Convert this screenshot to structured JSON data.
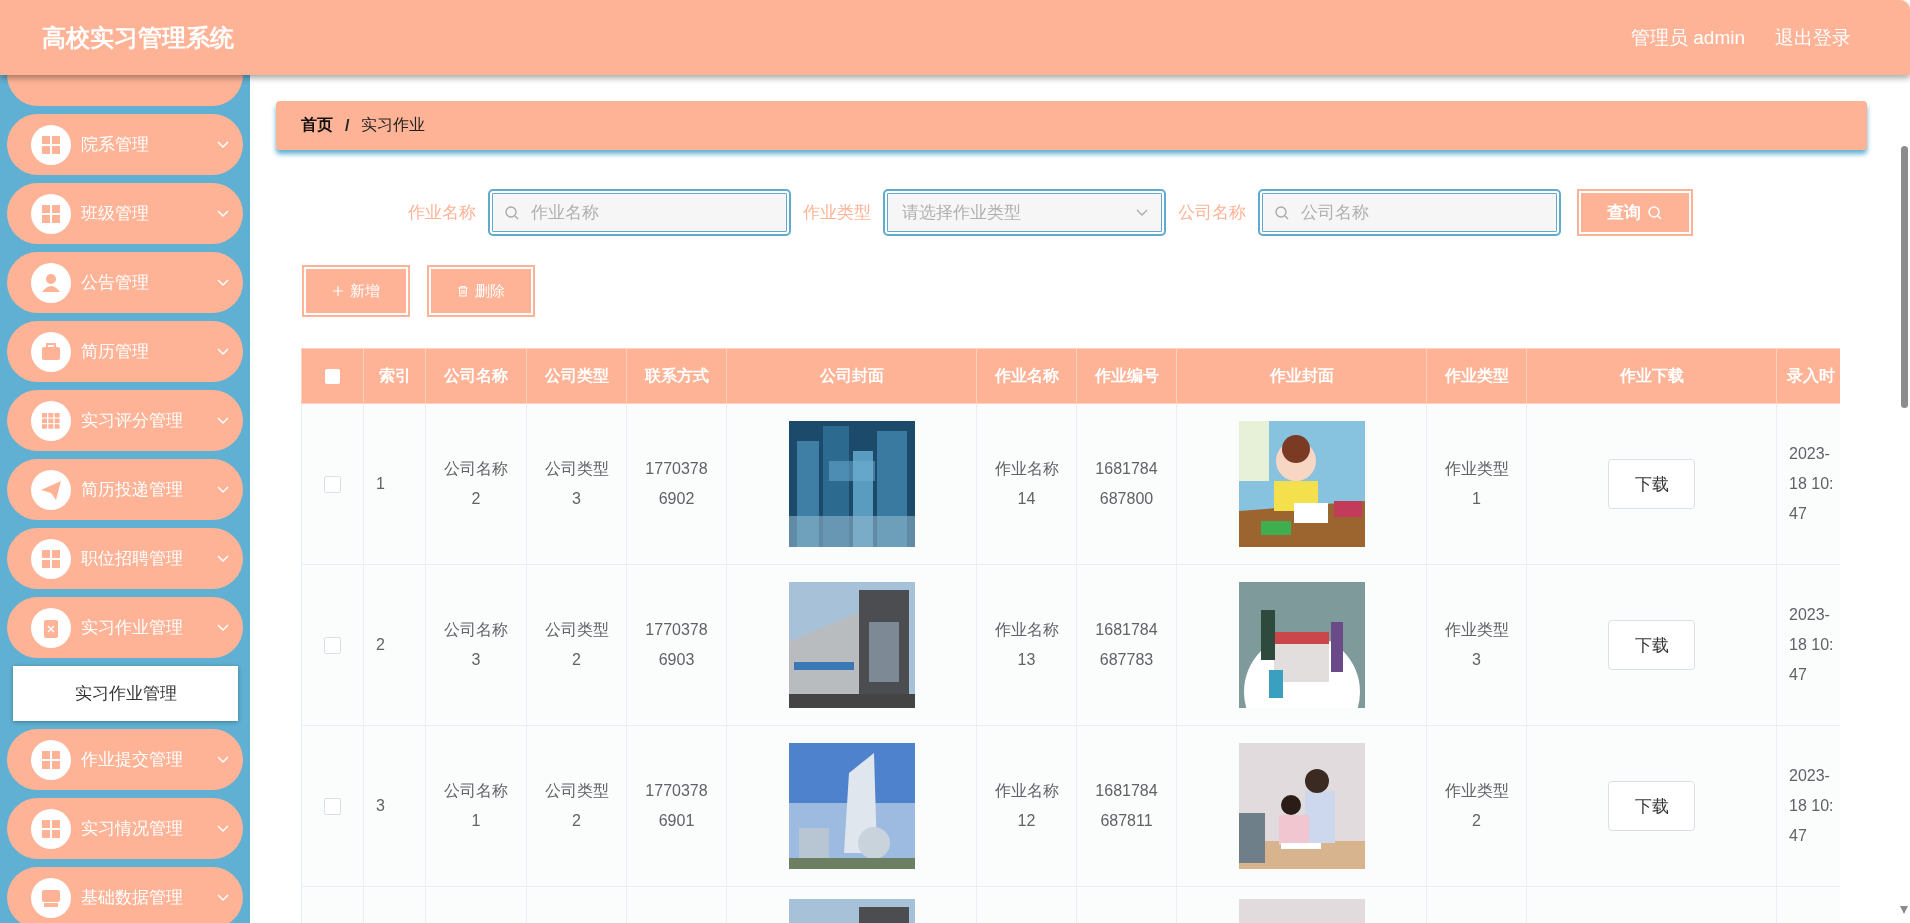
{
  "header": {
    "title": "高校实习管理系统",
    "user": "管理员 admin",
    "logout": "退出登录"
  },
  "sidebar": {
    "items": [
      {
        "label": "院系管理"
      },
      {
        "label": "班级管理"
      },
      {
        "label": "公告管理"
      },
      {
        "label": "简历管理"
      },
      {
        "label": "实习评分管理"
      },
      {
        "label": "简历投递管理"
      },
      {
        "label": "职位招聘管理"
      },
      {
        "label": "实习作业管理",
        "children": [
          {
            "label": "实习作业管理",
            "selected": true
          }
        ]
      },
      {
        "label": "作业提交管理"
      },
      {
        "label": "实习情况管理"
      },
      {
        "label": "基础数据管理"
      }
    ]
  },
  "breadcrumb": {
    "items": [
      "首页",
      "实习作业"
    ],
    "separator": "/"
  },
  "filters": [
    {
      "kind": "search",
      "label": "作业名称",
      "placeholder": "作业名称"
    },
    {
      "kind": "select",
      "label": "作业类型",
      "placeholder": "请选择作业类型"
    },
    {
      "kind": "search",
      "label": "公司名称",
      "placeholder": "公司名称"
    }
  ],
  "query_button": "查询",
  "actions": [
    {
      "kind": "add",
      "label": "新增"
    },
    {
      "kind": "delete",
      "label": "删除"
    }
  ],
  "table": {
    "select_all_checked": false,
    "columns": [
      "索引",
      "公司名称",
      "公司类型",
      "联系方式",
      "公司封面",
      "作业名称",
      "作业编号",
      "作业封面",
      "作业类型",
      "作业下载",
      "录入时"
    ],
    "rows": [
      {
        "checked": false,
        "index": "1",
        "company": "公司名称2",
        "company_type": "公司类型3",
        "phone": "17703786902",
        "homework": "作业名称14",
        "number": "1681784687800",
        "homework_type": "作业类型1",
        "download": "下载",
        "time": "2023-\n18 10:\n47"
      },
      {
        "checked": false,
        "index": "2",
        "company": "公司名称3",
        "company_type": "公司类型2",
        "phone": "17703786903",
        "homework": "作业名称13",
        "number": "1681784687783",
        "homework_type": "作业类型3",
        "download": "下载",
        "time": "2023-\n18 10:\n47"
      },
      {
        "checked": false,
        "index": "3",
        "company": "公司名称1",
        "company_type": "公司类型2",
        "phone": "17703786901",
        "homework": "作业名称12",
        "number": "1681784687811",
        "homework_type": "作业类型2",
        "download": "下载",
        "time": "2023-\n18 10:\n47"
      }
    ]
  }
}
